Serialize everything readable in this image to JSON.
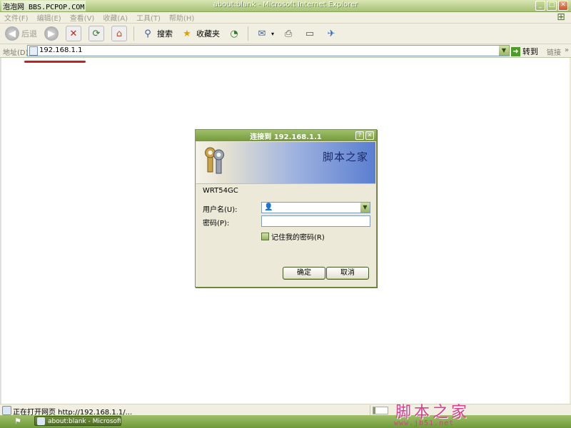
{
  "watermark_top": "泡泡网 BBS.PCPOP.COM",
  "window": {
    "title": "about:blank - Microsoft Internet Explorer",
    "controls": [
      "_",
      "□",
      "✕"
    ]
  },
  "menubar": {
    "items": [
      "文件(F)",
      "编辑(E)",
      "查看(V)",
      "收藏(A)",
      "工具(T)",
      "帮助(H)"
    ]
  },
  "toolbar": {
    "back_label": "后退",
    "search_label": "搜索",
    "favorites_label": "收藏夹"
  },
  "addressbar": {
    "label": "地址(D)",
    "value": "192.168.1.1",
    "go_label": "转到",
    "links_label": "链接",
    "links_more": "»"
  },
  "dialog": {
    "title": "连接到 192.168.1.1",
    "banner_text": "脚本之家",
    "router_name": "WRT54GC",
    "username_label": "用户名(U):",
    "password_label": "密码(P):",
    "remember_label": "记住我的密码(R)",
    "ok_label": "确定",
    "cancel_label": "取消"
  },
  "statusbar": {
    "text": "正在打开网页 http://192.168.1.1/...",
    "progress_fraction": 0.15
  },
  "taskbar": {
    "task_label": "about:blank - Microsoft..."
  },
  "watermark_bottom": {
    "title": "脚本之家",
    "url": "www.jb51.net"
  },
  "colors": {
    "accent_green": "#74993c",
    "underline_red": "#c42020",
    "watermark_pink": "#e03a8a"
  }
}
